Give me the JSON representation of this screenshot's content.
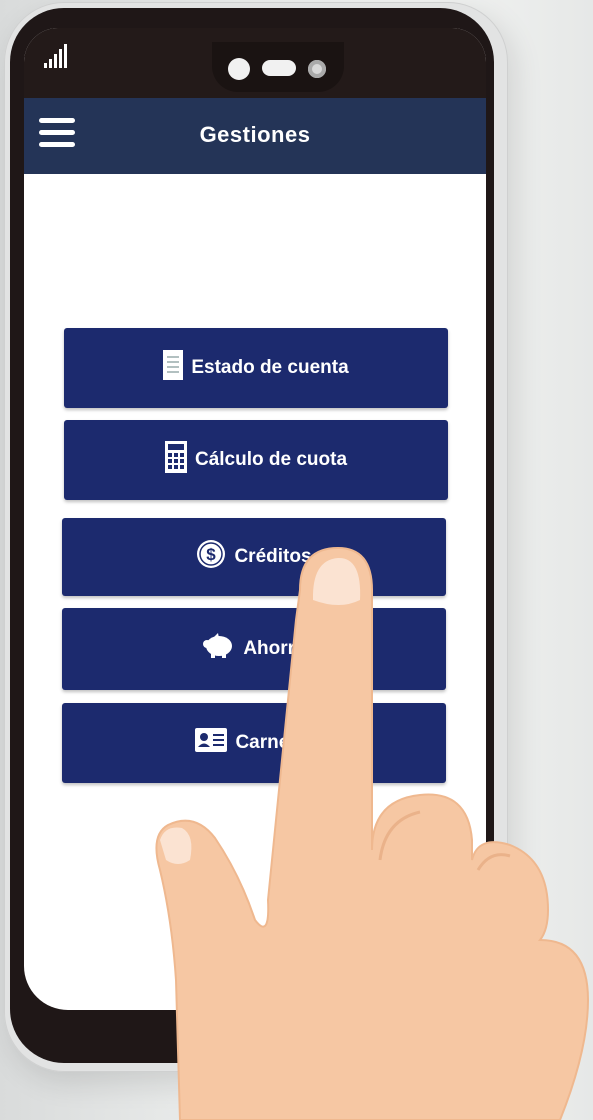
{
  "app": {
    "title": "Gestiones"
  },
  "menu": {
    "items": [
      {
        "label": "Estado de cuenta",
        "icon": "document-icon"
      },
      {
        "label": "Cálculo de cuota",
        "icon": "calculator-icon"
      },
      {
        "label": "Créditos",
        "icon": "dollar-coin-icon"
      },
      {
        "label": "Ahorro",
        "icon": "piggy-bank-icon"
      },
      {
        "label": "Carnet d",
        "icon": "id-card-icon"
      }
    ]
  },
  "colors": {
    "app_bar": "#243457",
    "button": "#1c2a6e",
    "status_bar": "#231a19",
    "skin": "#f6c7a3"
  }
}
